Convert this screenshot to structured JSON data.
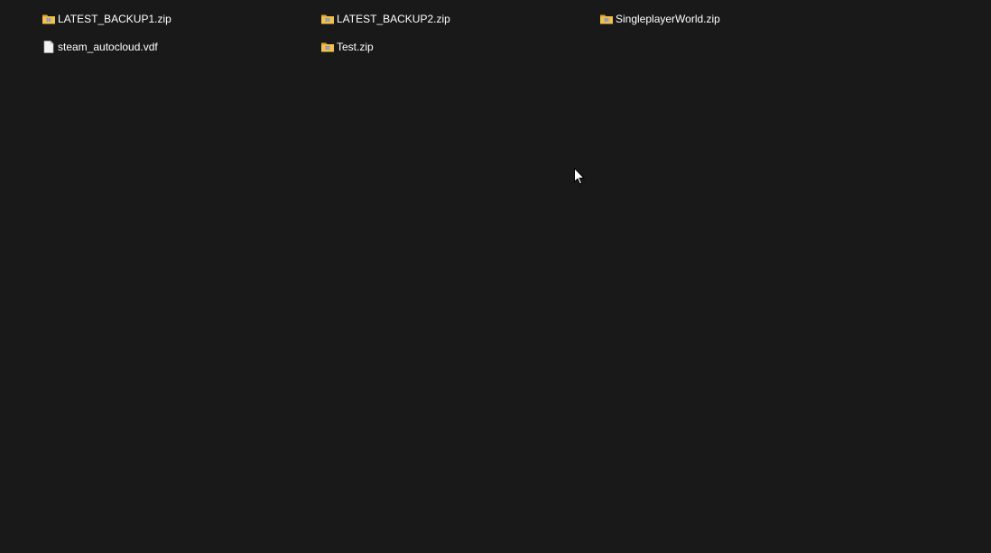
{
  "files": [
    {
      "name": "LATEST_BACKUP1.zip",
      "icon": "zip-folder-icon"
    },
    {
      "name": "LATEST_BACKUP2.zip",
      "icon": "zip-folder-icon"
    },
    {
      "name": "SingleplayerWorld.zip",
      "icon": "zip-folder-icon"
    },
    {
      "name": "steam_autocloud.vdf",
      "icon": "document-icon"
    },
    {
      "name": "Test.zip",
      "icon": "zip-folder-icon"
    }
  ],
  "colors": {
    "background": "#191919",
    "text": "#ffffff",
    "folder": "#f2c14e",
    "folder_dark": "#d9a22b",
    "document": "#f3f3f3"
  }
}
